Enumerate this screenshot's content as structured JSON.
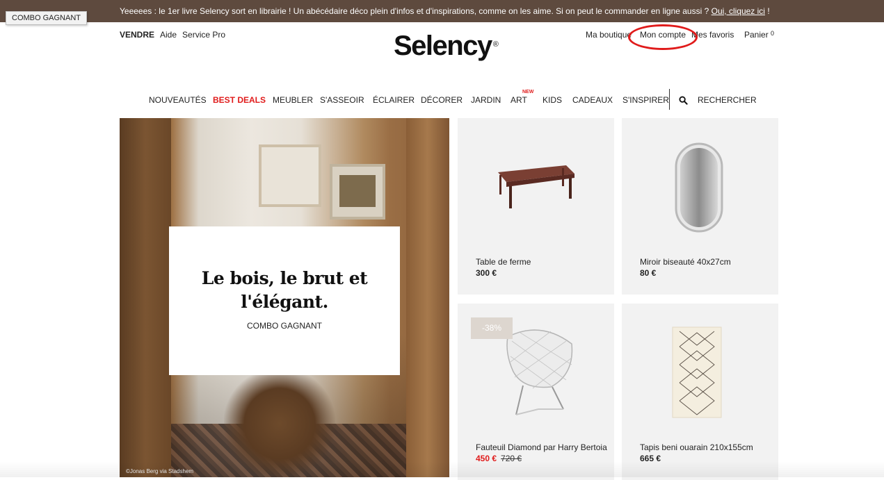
{
  "tooltip": "COMBO GAGNANT",
  "topbar": {
    "message": "Yeeeees  : le 1er livre Selency sort en librairie ! Un abécédaire déco plein d'infos et d'inspirations, comme on les aime. Si on peut le commander en ligne aussi ? ",
    "link": "Oui, cliquez ici",
    "end": " !"
  },
  "header": {
    "left": {
      "sell": "VENDRE",
      "help": "Aide",
      "pro": "Service Pro"
    },
    "logo": "Selency",
    "logo_mark": "®",
    "right": {
      "shop": "Ma boutique",
      "account": "Mon compte",
      "favorites": "Mes favoris",
      "cart": "Panier",
      "cart_count": "0"
    }
  },
  "nav": {
    "items": [
      "NOUVEAUTÉS",
      "BEST DEALS",
      "MEUBLER",
      "S'ASSEOIR",
      "ÉCLAIRER",
      "DÉCORER",
      "JARDIN",
      "ART",
      "KIDS",
      "CADEAUX",
      "S'INSPIRER"
    ],
    "new_badge": "NEW",
    "search": "RECHERCHER"
  },
  "hero": {
    "title": "Le bois, le brut et l'élégant.",
    "subtitle": "COMBO GAGNANT",
    "credit": "©Jonas Berg via Stadshem"
  },
  "products": [
    {
      "name": "Table de ferme",
      "price": "300 €"
    },
    {
      "name": "Miroir biseauté 40x27cm",
      "price": "80 €"
    },
    {
      "name": "Fauteuil Diamond par Harry Bertoia",
      "price": "450 €",
      "old_price": "720 €",
      "discount": "-38%"
    },
    {
      "name": "Tapis beni ouarain 210x155cm",
      "price": "665 €"
    }
  ],
  "colors": {
    "topbar": "#5e4a3e",
    "accent": "#e01b1b",
    "card_bg": "#f2f2f2"
  }
}
